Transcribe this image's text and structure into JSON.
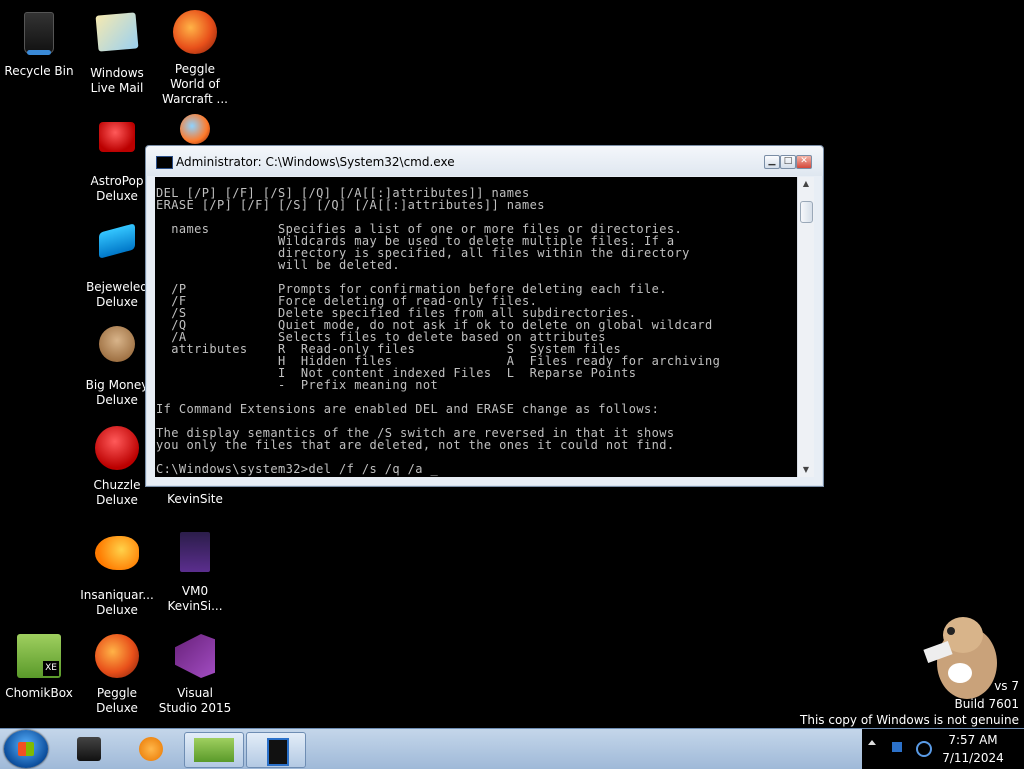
{
  "desktop": {
    "icons": [
      {
        "label": "Recycle Bin",
        "icon": "recycle-bin-icon"
      },
      {
        "label": "Windows Live Mail",
        "icon": "mail-icon"
      },
      {
        "label": "Peggle World of Warcraft ...",
        "icon": "peggle-icon"
      },
      {
        "label": "AstroPop Deluxe",
        "icon": "astropop-icon"
      },
      {
        "label": "Bejeweled Deluxe",
        "icon": "bejeweled-icon"
      },
      {
        "label": "Big Money Deluxe",
        "icon": "bigmoney-icon"
      },
      {
        "label": "Chuzzle Deluxe",
        "icon": "chuzzle-icon"
      },
      {
        "label": "KevinSite",
        "icon": "folder-icon"
      },
      {
        "label": "Insaniquar... Deluxe",
        "icon": "insaniquarium-icon"
      },
      {
        "label": "VM0 KevinSi...",
        "icon": "document-icon"
      },
      {
        "label": "ChomikBox",
        "icon": "chomikbox-icon"
      },
      {
        "label": "Peggle Deluxe",
        "icon": "peggle-icon"
      },
      {
        "label": "Visual Studio 2015",
        "icon": "visual-studio-icon"
      }
    ]
  },
  "cmd_window": {
    "title": "Administrator: C:\\Windows\\System32\\cmd.exe",
    "minimize_label": "▁",
    "maximize_label": "□",
    "close_label": "✕",
    "console_text": "DEL [/P] [/F] [/S] [/Q] [/A[[:]attributes]] names\nERASE [/P] [/F] [/S] [/Q] [/A[[:]attributes]] names\n\n  names         Specifies a list of one or more files or directories.\n                Wildcards may be used to delete multiple files. If a\n                directory is specified, all files within the directory\n                will be deleted.\n\n  /P            Prompts for confirmation before deleting each file.\n  /F            Force deleting of read-only files.\n  /S            Delete specified files from all subdirectories.\n  /Q            Quiet mode, do not ask if ok to delete on global wildcard\n  /A            Selects files to delete based on attributes\n  attributes    R  Read-only files            S  System files\n                H  Hidden files               A  Files ready for archiving\n                I  Not content indexed Files  L  Reparse Points\n                -  Prefix meaning not\n\nIf Command Extensions are enabled DEL and ERASE change as follows:\n\nThe display semantics of the /S switch are reversed in that it shows\nyou only the files that are deleted, not the ones it could not find.\n\nC:\\Windows\\system32>del /f /s /q /a ",
    "cursor": "_"
  },
  "taskbar": {
    "clock_time": "7:57 AM",
    "clock_date": "7/11/2024",
    "buttons": [
      "start",
      "explorer",
      "media-player",
      "chomikbox",
      "cmd"
    ]
  },
  "watermark": {
    "line1": "vs 7",
    "line2": "Build 7601",
    "line3": "This copy of Windows is not genuine"
  }
}
